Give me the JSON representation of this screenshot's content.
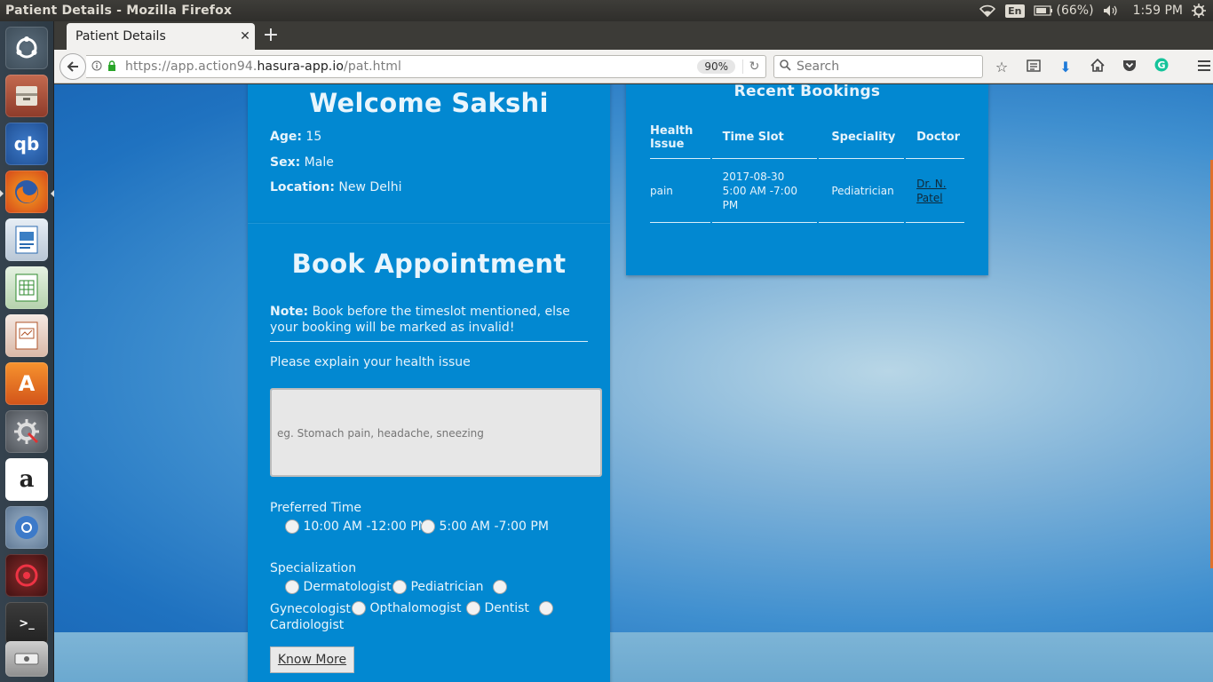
{
  "system": {
    "window_title": "Patient Details - Mozilla Firefox",
    "keyboard_layout": "En",
    "battery": "(66%)",
    "clock": "1:59 PM"
  },
  "browser": {
    "tab_title": "Patient Details",
    "url_prefix": "https://app.action94.",
    "url_domain": "hasura-app.io",
    "url_path": "/pat.html",
    "zoom": "90%",
    "search_placeholder": "Search"
  },
  "welcome": {
    "title": "Welcome Sakshi",
    "age_label": "Age:",
    "age_value": "15",
    "sex_label": "Sex:",
    "sex_value": "Male",
    "location_label": "Location:",
    "location_value": "New Delhi"
  },
  "booking_form": {
    "title": "Book Appointment",
    "note_label": "Note:",
    "note_text": "Book before the timeslot mentioned, else your booking will be marked as invalid!",
    "issue_label": "Please explain your health issue",
    "issue_placeholder": "eg. Stomach pain, headache, sneezing",
    "time_label": "Preferred Time",
    "time_options": [
      "10:00 AM -12:00 PM",
      "5:00 AM -7:00 PM"
    ],
    "specialization_label": "Specialization",
    "specializations": [
      "Dermatologist",
      "Pediatrician",
      "Gynecologist",
      "Opthalomogist",
      "Dentist",
      "Cardiologist"
    ],
    "know_more_label": "Know More"
  },
  "recent_bookings": {
    "title": "Recent Bookings",
    "headers": [
      "Health Issue",
      "Time Slot",
      "Speciality",
      "Doctor"
    ],
    "rows": [
      {
        "health_issue": "pain",
        "time_slot": "2017-08-30 5:00 AM -7:00 PM",
        "speciality": "Pediatrician",
        "doctor": "Dr. N. Patel"
      }
    ]
  },
  "colors": {
    "card_blue": "#0288d1",
    "page_bg": "#2a7fc9",
    "launcher_bg": "#35424e",
    "panel_bg": "#3c3b37"
  }
}
